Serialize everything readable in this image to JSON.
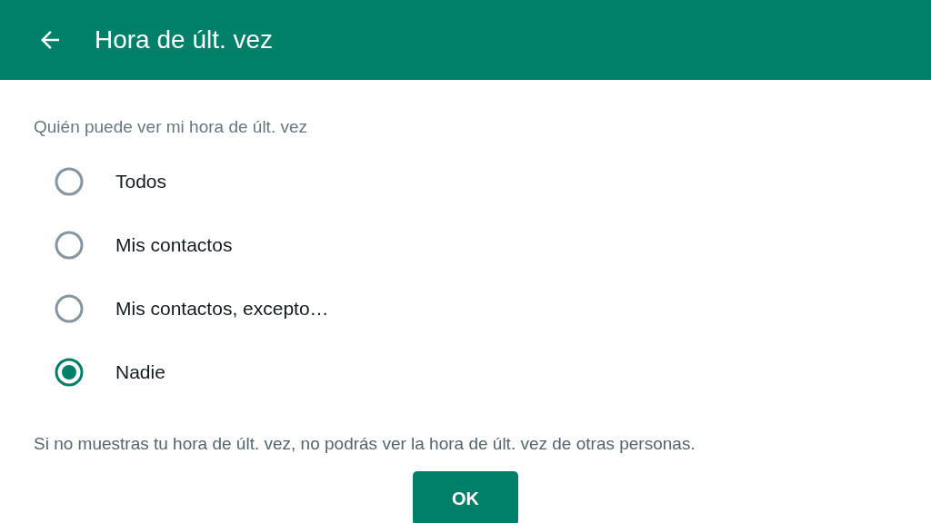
{
  "app_bar": {
    "title": "Hora de últ. vez"
  },
  "section_label": "Quién puede ver mi hora de últ. vez",
  "options": [
    {
      "label": "Todos",
      "selected": false
    },
    {
      "label": "Mis contactos",
      "selected": false
    },
    {
      "label": "Mis contactos, excepto…",
      "selected": false
    },
    {
      "label": "Nadie",
      "selected": true
    }
  ],
  "note": "Si no muestras tu hora de últ. vez, no podrás ver la hora de últ. vez de otras personas.",
  "buttons": [
    "OK"
  ]
}
